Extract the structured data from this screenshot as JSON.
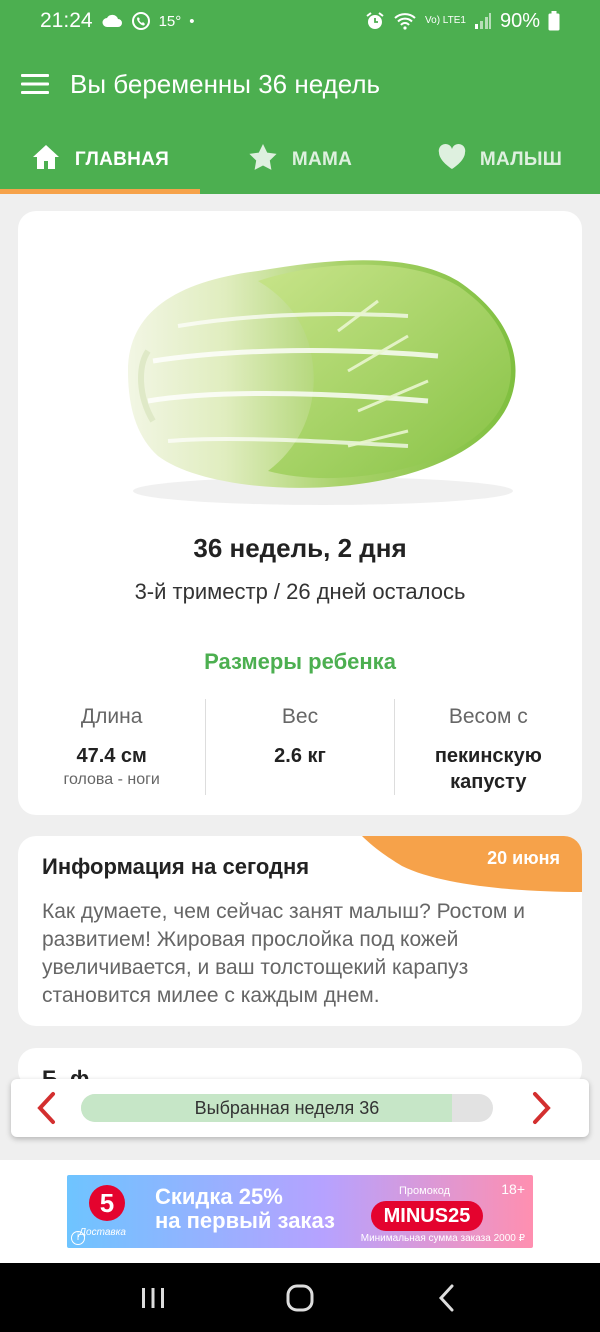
{
  "status_bar": {
    "time": "21:24",
    "temperature": "15°",
    "dot": "•",
    "battery": "90%",
    "network": "Vo) LTE1",
    "icons": [
      "cloud-icon",
      "phone-icon",
      "alarm-icon",
      "wifi-icon",
      "signal-icon",
      "battery-icon"
    ]
  },
  "app_bar": {
    "title": "Вы беременны 36 недель",
    "menu_icon": "hamburger-menu-icon"
  },
  "tabs": [
    {
      "label": "ГЛАВНАЯ",
      "icon": "home-icon",
      "active": true
    },
    {
      "label": "МАМА",
      "icon": "star-icon",
      "active": false
    },
    {
      "label": "МАЛЫШ",
      "icon": "heart-icon",
      "active": false
    }
  ],
  "main_card": {
    "image": "napa-cabbage-image",
    "week_title": "36 недель, 2 дня",
    "week_subtitle": "3-й триместр / 26 дней осталось",
    "sizes_title": "Размеры ребенка",
    "sizes": [
      {
        "label": "Длина",
        "value": "47.4 см",
        "note": "голова - ноги"
      },
      {
        "label": "Вес",
        "value": "2.6 кг",
        "note": ""
      },
      {
        "label": "Весом с",
        "value": "пекинскую капусту",
        "note": ""
      }
    ]
  },
  "info_card": {
    "title": "Информация на сегодня",
    "date": "20 июня",
    "text": "Как думаете, чем сейчас занят малыш? Ростом и развитием! Жировая прослойка под кожей увеличивается, и ваш толстощекий карапуз становится милее с каждым днем."
  },
  "partial_card": {
    "text": "Б..ф"
  },
  "week_selector": {
    "label": "Выбранная неделя 36",
    "progress": 0.9,
    "prev_icon": "chevron-left-icon",
    "next_icon": "chevron-right-icon"
  },
  "ad": {
    "logo": "5",
    "logo_sub": "Доставка",
    "headline_line1": "Скидка 25%",
    "headline_line2": "на первый заказ",
    "promo_label": "Промокод",
    "promo_code": "MINUS25",
    "age": "18+",
    "min_order": "Минимальная сумма заказа 2000 ₽",
    "info": "i"
  },
  "colors": {
    "primary": "#4caf50",
    "accent": "#f6a24a",
    "nav_arrow": "#d32f2f"
  }
}
